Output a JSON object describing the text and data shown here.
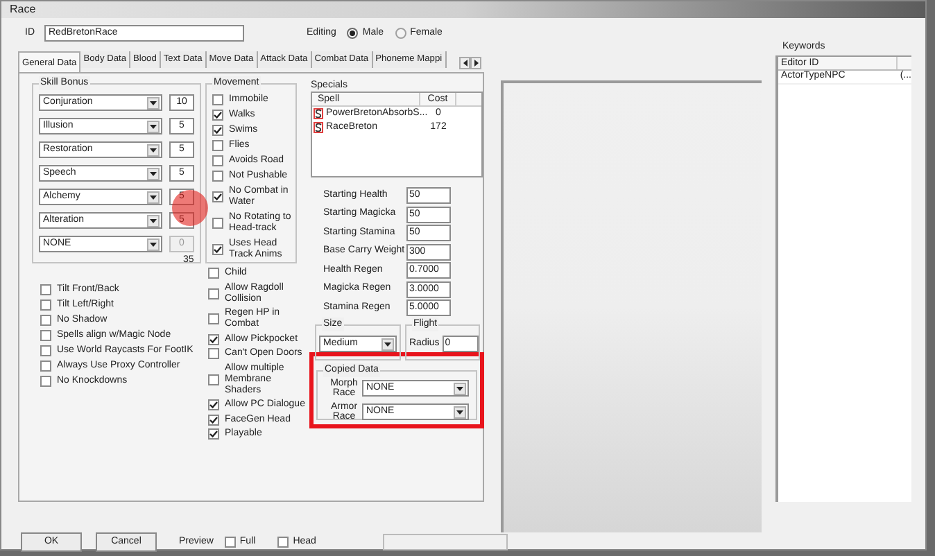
{
  "window": {
    "title": "Race"
  },
  "id_field": {
    "label": "ID",
    "value": "RedBretonRace"
  },
  "editing": {
    "label": "Editing",
    "options": [
      {
        "label": "Male",
        "selected": true
      },
      {
        "label": "Female",
        "selected": false
      }
    ]
  },
  "tabs": [
    {
      "label": "General Data",
      "selected": true
    },
    {
      "label": "Body Data",
      "selected": false
    },
    {
      "label": "Blood",
      "selected": false
    },
    {
      "label": "Text Data",
      "selected": false
    },
    {
      "label": "Move Data",
      "selected": false
    },
    {
      "label": "Attack Data",
      "selected": false
    },
    {
      "label": "Combat Data",
      "selected": false
    },
    {
      "label": "Phoneme Mappi",
      "selected": false
    }
  ],
  "skill_bonus": {
    "title": "Skill Bonus",
    "rows": [
      {
        "skill": "Conjuration",
        "value": "10",
        "disabled": false
      },
      {
        "skill": "Illusion",
        "value": "5",
        "disabled": false
      },
      {
        "skill": "Restoration",
        "value": "5",
        "disabled": false
      },
      {
        "skill": "Speech",
        "value": "5",
        "disabled": false
      },
      {
        "skill": "Alchemy",
        "value": "5",
        "disabled": false
      },
      {
        "skill": "Alteration",
        "value": "5",
        "disabled": false
      },
      {
        "skill": "NONE",
        "value": "0",
        "disabled": true
      }
    ],
    "total": "35"
  },
  "movement": {
    "title": "Movement",
    "items": [
      {
        "label": "Immobile",
        "checked": false
      },
      {
        "label": "Walks",
        "checked": true
      },
      {
        "label": "Swims",
        "checked": true
      },
      {
        "label": "Flies",
        "checked": false
      },
      {
        "label": "Avoids Road",
        "checked": false
      },
      {
        "label": "Not Pushable",
        "checked": false
      },
      {
        "label": "No Combat in Water",
        "checked": true
      },
      {
        "label": "No Rotating to Head-track",
        "checked": false
      },
      {
        "label": "Uses Head Track Anims",
        "checked": true
      }
    ]
  },
  "specials": {
    "title": "Specials",
    "columns": [
      "Spell",
      "Cost"
    ],
    "rows": [
      {
        "spell": "PowerBretonAbsorbS...",
        "cost": "0"
      },
      {
        "spell": "RaceBreton",
        "cost": "172"
      }
    ]
  },
  "stats": [
    {
      "label": "Starting Health",
      "value": "50"
    },
    {
      "label": "Starting Magicka",
      "value": "50"
    },
    {
      "label": "Starting Stamina",
      "value": "50"
    },
    {
      "label": "Base Carry Weight",
      "value": "300"
    },
    {
      "label": "Health Regen",
      "value": "0.7000"
    },
    {
      "label": "Magicka Regen",
      "value": "3.0000"
    },
    {
      "label": "Stamina Regen",
      "value": "5.0000"
    }
  ],
  "flags_left": [
    {
      "label": "Tilt Front/Back",
      "checked": false
    },
    {
      "label": "Tilt Left/Right",
      "checked": false
    },
    {
      "label": "No Shadow",
      "checked": false
    },
    {
      "label": "Spells align w/Magic Node",
      "checked": false
    },
    {
      "label": "Use World Raycasts For FootIK",
      "checked": false
    },
    {
      "label": "Always Use Proxy Controller",
      "checked": false
    },
    {
      "label": "No Knockdowns",
      "checked": false
    }
  ],
  "flags_middle": [
    {
      "label": "Child",
      "checked": false
    },
    {
      "label": "Allow Ragdoll Collision",
      "checked": false
    },
    {
      "label": "Regen HP in Combat",
      "checked": false
    },
    {
      "label": "Allow Pickpocket",
      "checked": true
    },
    {
      "label": "Can't Open Doors",
      "checked": false
    },
    {
      "label": "Allow multiple Membrane Shaders",
      "checked": false
    },
    {
      "label": "Allow PC Dialogue",
      "checked": true
    },
    {
      "label": "FaceGen Head",
      "checked": true
    },
    {
      "label": "Playable",
      "checked": true
    }
  ],
  "size": {
    "title": "Size",
    "value": "Medium"
  },
  "flight": {
    "title": "Flight",
    "label": "Radius",
    "value": "0"
  },
  "copied_data": {
    "title": "Copied Data",
    "rows": [
      {
        "label": "Morph Race",
        "value": "NONE"
      },
      {
        "label": "Armor Race",
        "value": "NONE"
      }
    ]
  },
  "keywords": {
    "title": "Keywords",
    "columns": [
      "Editor ID"
    ],
    "rows": [
      {
        "editor_id": "ActorTypeNPC",
        "column_2": "(..."
      }
    ]
  },
  "buttons": [
    "OK",
    "Cancel"
  ],
  "preview": {
    "label": "Preview",
    "options": [
      {
        "label": "Full",
        "checked": false
      },
      {
        "label": "Head",
        "checked": false
      }
    ]
  }
}
